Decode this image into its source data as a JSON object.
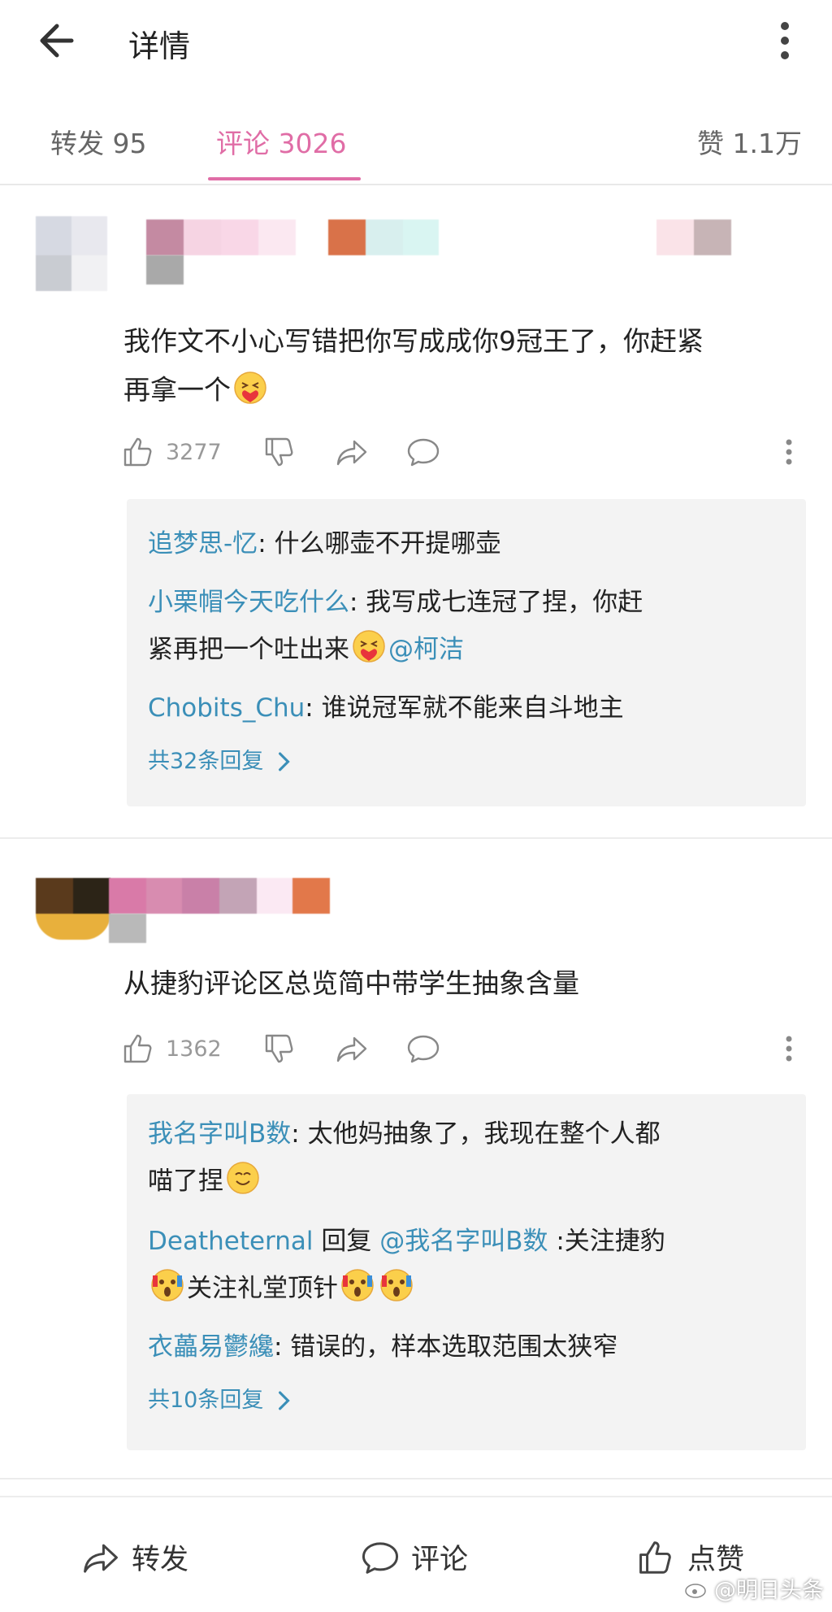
{
  "header": {
    "title": "详情"
  },
  "tabs": [
    {
      "label": "转发 95"
    },
    {
      "label": "评论 3026",
      "active": true
    },
    {
      "label": "赞 1.1万"
    }
  ],
  "comments": [
    {
      "text_lines": [
        "我作文不小心写错把你写成成你9冠王了，你赶紧",
        "再拿一个"
      ],
      "likes": "3277",
      "replies": [
        {
          "user": "追梦思-忆",
          "text": ": 什么哪壶不开提哪壶"
        },
        {
          "user": "小栗帽今天吃什么",
          "text": ": 我写成七连冠了捏，你赶",
          "text2": "紧再把一个吐出来",
          "mention": "@柯洁"
        },
        {
          "user": "Chobits_Chu",
          "text": ": 谁说冠军就不能来自斗地主"
        }
      ],
      "more_label": "共32条回复"
    },
    {
      "text_lines": [
        "从捷豹评论区总览简中带学生抽象含量"
      ],
      "likes": "1362",
      "replies": [
        {
          "user": "我名字叫B数",
          "text": ": 太他妈抽象了，我现在整个人都",
          "text2": "喵了捏"
        },
        {
          "user": "Deatheternal",
          "reply_word": " 回复 ",
          "mention": "@我名字叫B数",
          "text": " :关注捷豹",
          "text2": "关注礼堂顶针"
        },
        {
          "user": "衣藟易鬱纔",
          "text": ": 错误的，样本选取范围太狭窄"
        }
      ],
      "more_label": "共10条回复"
    }
  ],
  "bottom_bar": {
    "repost": "转发",
    "comment": "评论",
    "like": "点赞"
  },
  "watermark": "@明日头条",
  "colors": {
    "accent": "#e06da6",
    "username": "#3b8fb8",
    "reply_bg": "#f3f3f3"
  }
}
